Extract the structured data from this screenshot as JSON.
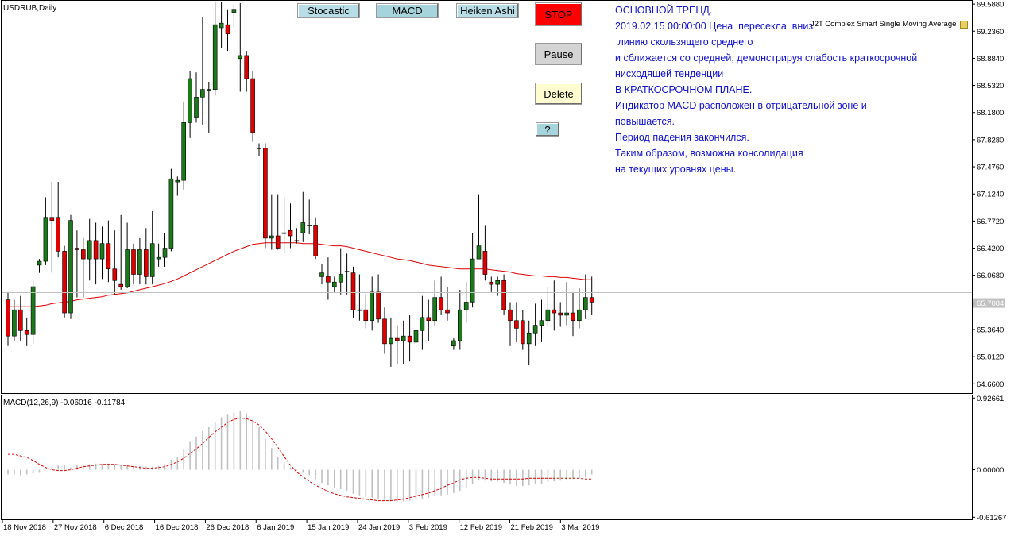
{
  "symbol_label": "USDRUB,Daily",
  "macd_label": "MACD(12,26,9) -0.06016 -0.11784",
  "indicator_label": "J2T Complex Smart Single Moving Average",
  "buttons": {
    "stocastic": "Stocastic",
    "macd": "MACD",
    "heiken": "Heiken Ashi",
    "stop": "STOP",
    "pause": "Pause",
    "delete": "Delete",
    "help": "?"
  },
  "comment_lines": [
    "ОСНОВНОЙ ТРЕНД.",
    "",
    "2019.02.15 00:00:00 Цена  пересекла  вниз",
    " линию скользящего среднего",
    "и сближается со средней, демонстрируя слабость краткосрочной",
    "нисходящей тенденции",
    "В КРАТКОСРОЧНОМ ПЛАНЕ.",
    "Индикатор MACD расположен в отрицательной зоне и",
    "повышается.",
    "Период падения закончился.",
    "Таким образом, возможна консолидация",
    "на текущих уровнях цены."
  ],
  "colors": {
    "bull": "#1a7a1a",
    "bear": "#e00000",
    "ma": "#e00000",
    "comment": "#1010d0",
    "current_price_tag": "#c0c0c0"
  },
  "chart_data": [
    {
      "type": "candlestick",
      "symbol": "USDRUB",
      "timeframe": "Daily",
      "ylim": [
        64.55,
        69.62
      ],
      "y_ticks": [
        "69.5880",
        "69.2360",
        "68.8840",
        "68.5320",
        "68.1800",
        "67.8280",
        "67.4760",
        "67.1240",
        "66.7720",
        "66.4200",
        "66.0680",
        "65.7084",
        "65.3640",
        "65.0120",
        "64.6600"
      ],
      "current_price": "65.7084",
      "x_labels": [
        "18 Nov 2018",
        "27 Nov 2018",
        "6 Dec 2018",
        "16 Dec 2018",
        "26 Dec 2018",
        "6 Jan 2019",
        "15 Jan 2019",
        "24 Jan 2019",
        "3 Feb 2019",
        "12 Feb 2019",
        "21 Feb 2019",
        "3 Mar 2019"
      ],
      "candles": [
        [
          65.75,
          65.28,
          65.85,
          65.15
        ],
        [
          65.28,
          65.62,
          65.75,
          65.22
        ],
        [
          65.62,
          65.35,
          65.8,
          65.22
        ],
        [
          65.35,
          65.3,
          65.52,
          65.15
        ],
        [
          65.3,
          65.92,
          66.0,
          65.18
        ],
        [
          66.2,
          66.25,
          66.28,
          66.1
        ],
        [
          66.25,
          66.82,
          67.08,
          66.2
        ],
        [
          66.82,
          66.78,
          67.28,
          66.1
        ],
        [
          66.82,
          66.38,
          67.28,
          66.3
        ],
        [
          66.38,
          65.58,
          66.45,
          65.52
        ],
        [
          65.58,
          66.78,
          66.85,
          65.5
        ],
        [
          66.42,
          66.4,
          66.65,
          65.78
        ],
        [
          66.4,
          66.28,
          66.55,
          65.78
        ],
        [
          66.28,
          66.52,
          66.8,
          66.0
        ],
        [
          66.52,
          66.28,
          66.75,
          65.95
        ],
        [
          66.28,
          66.48,
          66.7,
          66.02
        ],
        [
          66.48,
          66.15,
          66.78,
          65.98
        ],
        [
          66.15,
          66.0,
          66.65,
          65.82
        ],
        [
          65.95,
          65.92,
          66.85,
          65.88
        ],
        [
          65.92,
          66.4,
          66.75,
          65.9
        ],
        [
          66.4,
          66.08,
          66.48,
          65.95
        ],
        [
          66.08,
          66.4,
          66.55,
          65.95
        ],
        [
          66.4,
          66.05,
          66.68,
          65.95
        ],
        [
          66.05,
          66.48,
          66.9,
          65.95
        ],
        [
          66.28,
          66.3,
          66.48,
          66.18
        ],
        [
          66.3,
          66.42,
          66.62,
          66.18
        ],
        [
          66.42,
          67.32,
          67.45,
          66.38
        ],
        [
          67.28,
          67.3,
          67.35,
          67.1
        ],
        [
          67.3,
          68.05,
          68.32,
          67.18
        ],
        [
          68.05,
          68.62,
          68.72,
          67.85
        ],
        [
          68.12,
          68.38,
          68.7,
          68.05
        ],
        [
          68.38,
          68.48,
          69.42,
          68.02
        ],
        [
          68.48,
          68.48,
          68.58,
          67.92
        ],
        [
          68.48,
          69.32,
          69.62,
          68.4
        ],
        [
          69.28,
          69.34,
          69.62,
          69.02
        ],
        [
          69.32,
          69.2,
          69.52,
          68.98
        ],
        [
          69.48,
          69.52,
          69.58,
          69.28
        ],
        [
          68.88,
          68.92,
          69.6,
          68.45
        ],
        [
          68.92,
          68.62,
          68.98,
          68.45
        ],
        [
          68.62,
          67.92,
          68.72,
          67.8
        ],
        [
          67.72,
          67.72,
          67.78,
          67.62
        ],
        [
          67.72,
          66.55,
          67.78,
          66.42
        ],
        [
          66.55,
          66.58,
          67.12,
          66.4
        ],
        [
          66.58,
          66.42,
          67.12,
          66.4
        ],
        [
          66.62,
          66.62,
          67.08,
          66.35
        ],
        [
          66.65,
          66.58,
          67.0,
          66.42
        ],
        [
          66.52,
          66.52,
          66.68,
          66.48
        ],
        [
          66.62,
          66.75,
          67.15,
          66.5
        ],
        [
          66.72,
          66.72,
          67.05,
          66.6
        ],
        [
          66.72,
          66.32,
          66.82,
          66.28
        ],
        [
          66.05,
          66.1,
          66.22,
          65.95
        ],
        [
          66.05,
          65.98,
          66.3,
          65.75
        ],
        [
          65.92,
          65.98,
          66.05,
          65.85
        ],
        [
          65.98,
          66.08,
          66.42,
          65.82
        ],
        [
          66.12,
          66.12,
          66.35,
          65.82
        ],
        [
          66.1,
          65.62,
          66.18,
          65.52
        ],
        [
          65.62,
          65.62,
          66.08,
          65.48
        ],
        [
          65.62,
          65.48,
          65.82,
          65.38
        ],
        [
          65.48,
          65.85,
          66.05,
          65.35
        ],
        [
          65.85,
          65.5,
          66.08,
          65.45
        ],
        [
          65.5,
          65.18,
          65.65,
          65.05
        ],
        [
          65.18,
          65.25,
          65.52,
          64.88
        ],
        [
          65.25,
          65.22,
          65.42,
          64.92
        ],
        [
          65.22,
          65.28,
          65.48,
          64.92
        ],
        [
          65.28,
          65.2,
          65.55,
          64.95
        ],
        [
          65.2,
          65.35,
          65.52,
          64.95
        ],
        [
          65.35,
          65.52,
          65.8,
          65.1
        ],
        [
          65.52,
          65.48,
          65.75,
          65.22
        ],
        [
          65.48,
          65.78,
          66.0,
          65.42
        ],
        [
          65.78,
          65.62,
          66.05,
          65.55
        ],
        [
          65.62,
          65.58,
          65.92,
          65.48
        ],
        [
          65.15,
          65.22,
          65.25,
          65.1
        ],
        [
          65.22,
          65.62,
          65.88,
          65.1
        ],
        [
          65.62,
          65.72,
          65.98,
          65.45
        ],
        [
          65.72,
          66.28,
          66.62,
          65.65
        ],
        [
          66.28,
          66.45,
          67.12,
          66.28
        ],
        [
          66.38,
          66.08,
          66.72,
          66.0
        ],
        [
          65.98,
          65.95,
          66.05,
          65.85
        ],
        [
          65.95,
          66.0,
          66.05,
          65.8
        ],
        [
          66.0,
          65.62,
          66.08,
          65.55
        ],
        [
          65.62,
          65.48,
          65.72,
          65.15
        ],
        [
          65.48,
          65.38,
          65.72,
          65.2
        ],
        [
          65.48,
          65.18,
          65.62,
          65.1
        ],
        [
          65.18,
          65.32,
          65.48,
          64.9
        ],
        [
          65.32,
          65.42,
          65.7,
          65.15
        ],
        [
          65.42,
          65.48,
          65.75,
          65.2
        ],
        [
          65.48,
          65.62,
          65.92,
          65.4
        ],
        [
          65.62,
          65.58,
          66.0,
          65.35
        ],
        [
          65.58,
          65.55,
          65.72,
          65.4
        ],
        [
          65.55,
          65.58,
          65.98,
          65.42
        ],
        [
          65.58,
          65.48,
          65.85,
          65.28
        ],
        [
          65.48,
          65.62,
          65.9,
          65.38
        ],
        [
          65.62,
          65.78,
          66.08,
          65.5
        ],
        [
          65.78,
          65.72,
          66.05,
          65.55
        ]
      ],
      "ma": [
        65.66,
        65.66,
        65.66,
        65.66,
        65.66,
        65.67,
        65.68,
        65.7,
        65.71,
        65.72,
        65.73,
        65.75,
        65.76,
        65.77,
        65.78,
        65.79,
        65.81,
        65.82,
        65.83,
        65.84,
        65.86,
        65.88,
        65.9,
        65.92,
        65.94,
        65.96,
        65.99,
        66.02,
        66.06,
        66.1,
        66.14,
        66.18,
        66.22,
        66.26,
        66.3,
        66.34,
        66.38,
        66.41,
        66.44,
        66.47,
        66.48,
        66.49,
        66.49,
        66.49,
        66.49,
        66.49,
        66.49,
        66.48,
        66.48,
        66.48,
        66.47,
        66.46,
        66.45,
        66.45,
        66.44,
        66.42,
        66.4,
        66.38,
        66.36,
        66.34,
        66.32,
        66.3,
        66.28,
        66.27,
        66.26,
        66.24,
        66.22,
        66.2,
        66.19,
        66.18,
        66.17,
        66.16,
        66.15,
        66.15,
        66.15,
        66.15,
        66.15,
        66.14,
        66.13,
        66.12,
        66.11,
        66.09,
        66.08,
        66.07,
        66.06,
        66.06,
        66.05,
        66.05,
        66.04,
        66.04,
        66.03,
        66.02,
        66.01,
        66.01
      ]
    },
    {
      "type": "bar",
      "name": "MACD(12,26,9)",
      "ylim": [
        -0.63,
        0.95
      ],
      "y_ticks": [
        "0.92661",
        "0.00000",
        "-0.61267"
      ],
      "histogram": [
        -0.06,
        -0.06,
        -0.07,
        -0.06,
        -0.05,
        -0.04,
        0.0,
        0.04,
        0.06,
        0.06,
        0.03,
        0.06,
        0.07,
        0.07,
        0.08,
        0.08,
        0.08,
        0.07,
        0.06,
        0.06,
        0.04,
        0.05,
        0.04,
        0.04,
        0.05,
        0.07,
        0.13,
        0.17,
        0.26,
        0.37,
        0.43,
        0.5,
        0.55,
        0.62,
        0.68,
        0.72,
        0.74,
        0.76,
        0.73,
        0.65,
        0.55,
        0.4,
        0.28,
        0.16,
        0.09,
        0.03,
        -0.01,
        -0.04,
        -0.07,
        -0.12,
        -0.17,
        -0.2,
        -0.23,
        -0.25,
        -0.27,
        -0.31,
        -0.33,
        -0.35,
        -0.36,
        -0.38,
        -0.39,
        -0.4,
        -0.41,
        -0.41,
        -0.4,
        -0.39,
        -0.38,
        -0.36,
        -0.34,
        -0.33,
        -0.32,
        -0.3,
        -0.27,
        -0.23,
        -0.18,
        -0.14,
        -0.14,
        -0.15,
        -0.15,
        -0.17,
        -0.19,
        -0.21,
        -0.21,
        -0.2,
        -0.19,
        -0.18,
        -0.16,
        -0.15,
        -0.14,
        -0.13,
        -0.12,
        -0.11,
        -0.1,
        -0.06
      ],
      "signal": [
        0.2,
        0.2,
        0.18,
        0.16,
        0.12,
        0.07,
        0.03,
        0.0,
        -0.01,
        -0.01,
        0.0,
        0.02,
        0.04,
        0.05,
        0.06,
        0.07,
        0.07,
        0.07,
        0.06,
        0.05,
        0.04,
        0.03,
        0.02,
        0.02,
        0.03,
        0.04,
        0.07,
        0.1,
        0.15,
        0.21,
        0.27,
        0.34,
        0.42,
        0.49,
        0.55,
        0.61,
        0.65,
        0.67,
        0.66,
        0.63,
        0.58,
        0.5,
        0.4,
        0.29,
        0.17,
        0.06,
        -0.03,
        -0.09,
        -0.15,
        -0.2,
        -0.24,
        -0.28,
        -0.31,
        -0.33,
        -0.35,
        -0.36,
        -0.37,
        -0.38,
        -0.39,
        -0.4,
        -0.4,
        -0.4,
        -0.39,
        -0.38,
        -0.36,
        -0.34,
        -0.32,
        -0.3,
        -0.27,
        -0.24,
        -0.2,
        -0.17,
        -0.13,
        -0.11,
        -0.1,
        -0.1,
        -0.11,
        -0.12,
        -0.12,
        -0.12,
        -0.12,
        -0.12,
        -0.12,
        -0.11,
        -0.11,
        -0.11,
        -0.11,
        -0.11,
        -0.11,
        -0.11,
        -0.11,
        -0.11,
        -0.12,
        -0.12
      ]
    }
  ]
}
